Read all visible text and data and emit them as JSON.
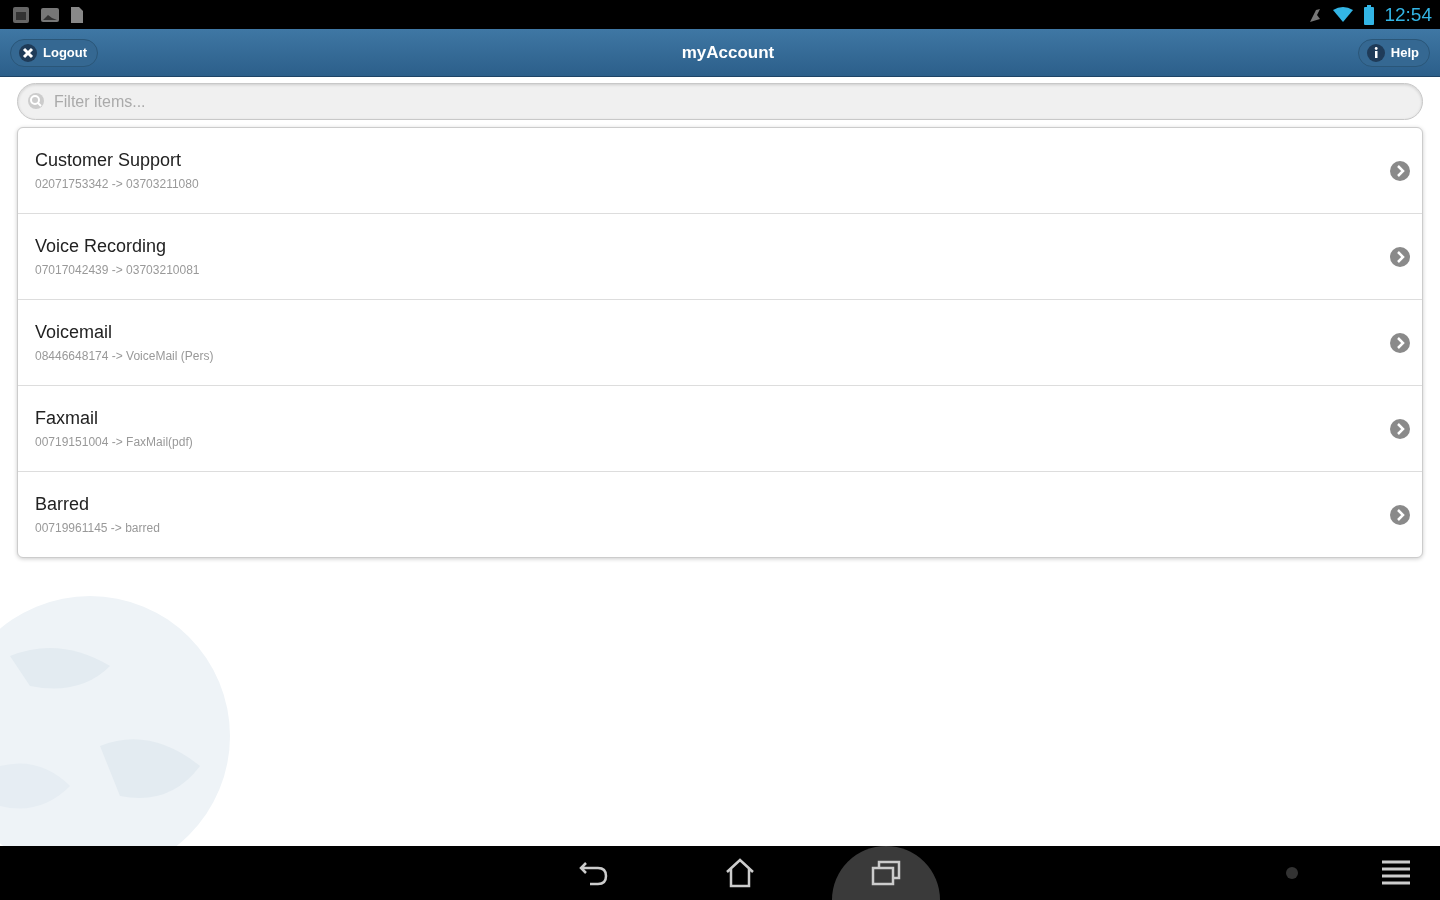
{
  "status_bar": {
    "time": "12:54"
  },
  "header": {
    "title": "myAccount",
    "left_button": "Logout",
    "right_button": "Help"
  },
  "search": {
    "placeholder": "Filter items..."
  },
  "items": [
    {
      "title": "Customer Support",
      "subtitle": "02071753342 -> 03703211080"
    },
    {
      "title": "Voice Recording",
      "subtitle": "07017042439 -> 03703210081"
    },
    {
      "title": "Voicemail",
      "subtitle": "08446648174 -> VoiceMail (Pers)"
    },
    {
      "title": "Faxmail",
      "subtitle": "00719151004 -> FaxMail(pdf)"
    },
    {
      "title": "Barred",
      "subtitle": "00719961145 -> barred"
    }
  ],
  "nav_bar": [
    {
      "kind": "back",
      "selected": false
    },
    {
      "kind": "home",
      "selected": false
    },
    {
      "kind": "recents",
      "selected": true
    }
  ]
}
